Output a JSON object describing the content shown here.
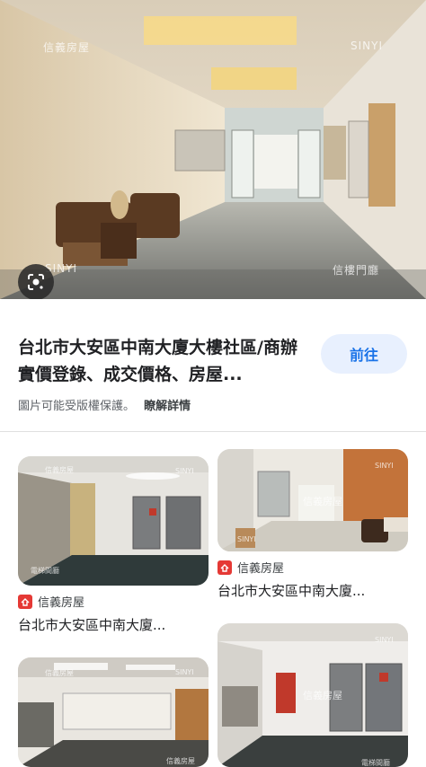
{
  "hero": {
    "watermark_left": "信義房屋",
    "watermark_right": "SINYI",
    "watermark_bottom_left": "SINYI",
    "watermark_bottom_right": "信樓門廳",
    "lens_icon": "lens-icon"
  },
  "result": {
    "title": "台北市大安區中南大廈大樓社區/商辦實價登錄、成交價格、房屋...",
    "go_label": "前往",
    "copyright_note": "圖片可能受版權保護。",
    "details_link": "瞭解詳情"
  },
  "related": [
    {
      "source": "信義房屋",
      "caption": "台北市大安區中南大廈...",
      "wm1": "信義房屋",
      "wm2": "SINYI",
      "wm3": "電梯間廳"
    },
    {
      "source": "信義房屋",
      "caption": "台北市大安區中南大廈...",
      "wm1": "信義房屋",
      "wm2": "SINYI",
      "wm3": "SINYI"
    },
    {
      "wm1": "信義房屋",
      "wm2": "SINYI",
      "wm3": "信義房屋"
    },
    {
      "wm1": "信義房屋",
      "wm2": "SINYI",
      "wm3": "電梯間廳"
    }
  ],
  "colors": {
    "accent": "#1a73e8",
    "button_bg": "#e8f0fe",
    "source_logo": "#e53935"
  }
}
